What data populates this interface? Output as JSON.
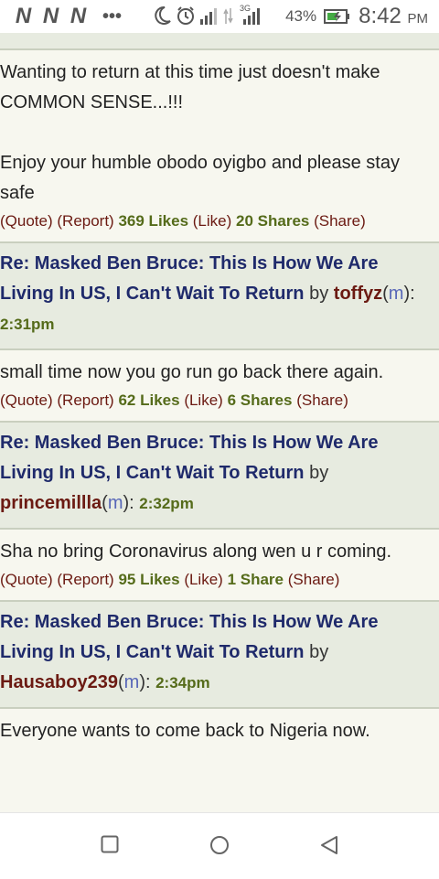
{
  "status": {
    "carrier_logos": [
      "N",
      "N",
      "N"
    ],
    "more_dots": "•••",
    "network_badge": "3G",
    "battery_percent": "43%",
    "time": "8:42",
    "ampm": "PM"
  },
  "thread": {
    "first_post": {
      "lines": [
        "Wanting to return at this time just doesn't make COMMON SENSE...!!!",
        "Enjoy your humble obodo oyigbo and please stay safe"
      ],
      "likes": "369 Likes",
      "shares": "20 Shares"
    },
    "labels": {
      "quote": "(Quote)",
      "report": "(Report)",
      "like": "(Like)",
      "share": "(Share)",
      "by": "by",
      "m": "m"
    },
    "posts": [
      {
        "title": "Re: Masked Ben Bruce: This Is How We Are Living In US, I Can't Wait To Return",
        "user": "toffyz",
        "time": "2:31pm",
        "text": "small time now you go run go back there again.",
        "likes": "62 Likes",
        "shares": "6 Shares"
      },
      {
        "title": "Re: Masked Ben Bruce: This Is How We Are Living In US, I Can't Wait To Return",
        "user": "princemillla",
        "time": "2:32pm",
        "text": "Sha no bring Coronavirus along wen u r coming.",
        "likes": "95 Likes",
        "shares": "1 Share"
      },
      {
        "title": "Re: Masked Ben Bruce: This Is How We Are Living In US, I Can't Wait To Return",
        "user": "Hausaboy239",
        "time": "2:34pm",
        "text": "Everyone wants to come back to Nigeria now."
      }
    ]
  },
  "navbar": {
    "icons": [
      "square-recents-icon",
      "circle-home-icon",
      "triangle-back-icon"
    ]
  },
  "colors": {
    "title": "#1f2a6b",
    "user": "#6b1a12",
    "time": "#556b1a",
    "mod_link": "#5867b8",
    "header_bg": "#e7ebe0",
    "post_bg": "#f7f7ef"
  }
}
